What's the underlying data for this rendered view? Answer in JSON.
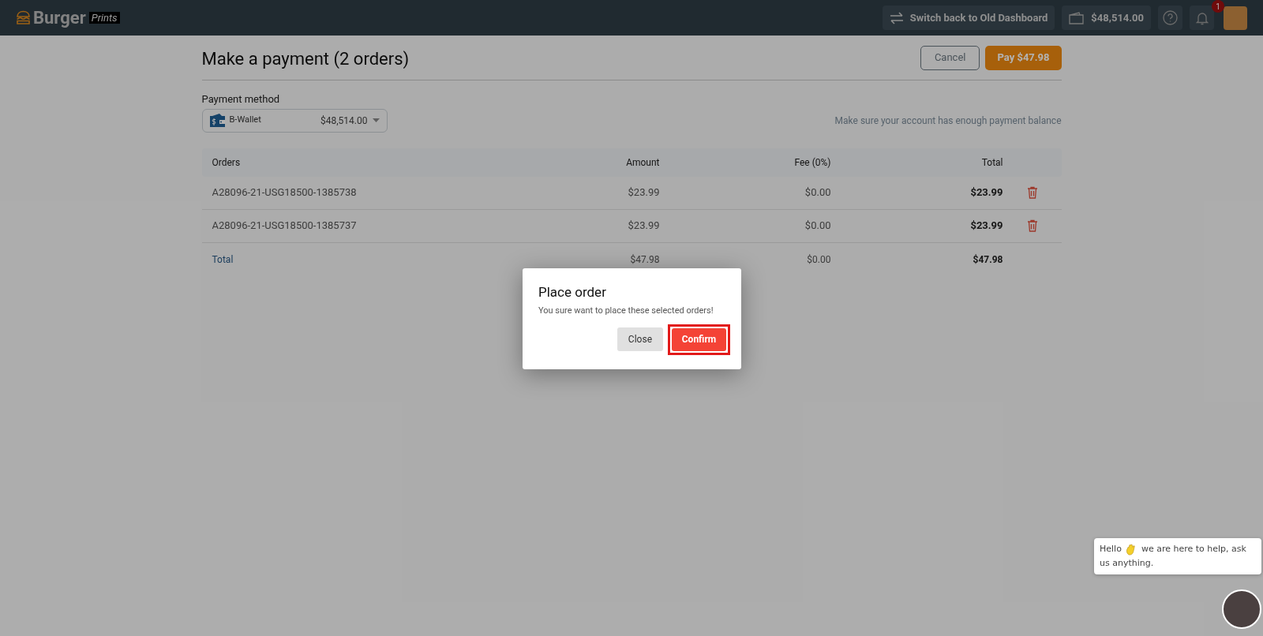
{
  "top_bar": {
    "logo": {
      "brand": "Burger",
      "tag": "Prints"
    },
    "switch_button": "Switch back to Old Dashboard",
    "balance": "$48,514.00",
    "notification_count": "1"
  },
  "page": {
    "title": "Make a payment (2 orders)",
    "cancel_button": "Cancel",
    "pay_button": "Pay $47.98"
  },
  "payment_method": {
    "label": "Payment method",
    "name": "B-Wallet",
    "amount": "$48,514.00",
    "note": "Make sure your account has enough payment balance"
  },
  "table": {
    "columns": [
      "Orders",
      "Amount",
      "Fee (0%)",
      "Total"
    ],
    "rows": [
      {
        "order": "A28096-21-USG18500-1385738",
        "amount": "$23.99",
        "fee": "$0.00",
        "total": "$23.99"
      },
      {
        "order": "A28096-21-USG18500-1385737",
        "amount": "$23.99",
        "fee": "$0.00",
        "total": "$23.99"
      }
    ],
    "total_row": {
      "label": "Total",
      "amount": "$47.98",
      "fee": "$0.00",
      "total": "$47.98"
    }
  },
  "dialog": {
    "title": "Place order",
    "message": "You sure want to place these selected orders!",
    "close_button": "Close",
    "confirm_button": "Confirm"
  },
  "chat": {
    "greeting": "Hello",
    "message_lines": [
      "we are here to help, ask",
      "us anything."
    ]
  }
}
